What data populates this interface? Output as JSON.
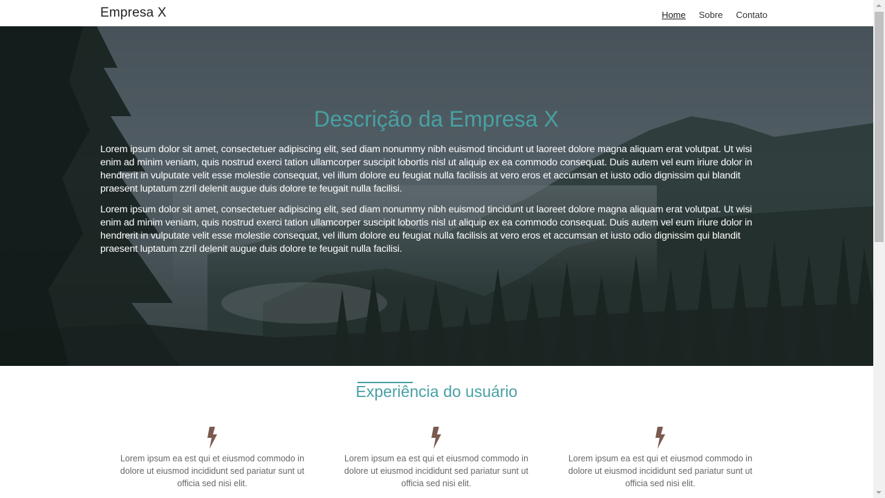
{
  "navbar": {
    "brand": "Empresa X",
    "links": [
      {
        "label": "Home",
        "active": true
      },
      {
        "label": "Sobre",
        "active": false
      },
      {
        "label": "Contato",
        "active": false
      }
    ]
  },
  "hero": {
    "title": "Descrição da Empresa X",
    "paragraphs": [
      "Lorem ipsum dolor sit amet, consectetuer adipiscing elit, sed diam nonummy nibh euismod tincidunt ut laoreet dolore magna aliquam erat volutpat. Ut wisi enim ad minim veniam, quis nostrud exerci tation ullamcorper suscipit lobortis nisl ut aliquip ex ea commodo consequat. Duis autem vel eum iriure dolor in hendrerit in vulputate velit esse molestie consequat, vel illum dolore eu feugiat nulla facilisis at vero eros et accumsan et iusto odio dignissim qui blandit praesent luptatum zzril delenit augue duis dolore te feugait nulla facilisi.",
      "Lorem ipsum dolor sit amet, consectetuer adipiscing elit, sed diam nonummy nibh euismod tincidunt ut laoreet dolore magna aliquam erat volutpat. Ut wisi enim ad minim veniam, quis nostrud exerci tation ullamcorper suscipit lobortis nisl ut aliquip ex ea commodo consequat. Duis autem vel eum iriure dolor in hendrerit in vulputate velit esse molestie consequat, vel illum dolore eu feugiat nulla facilisis at vero eros et accumsan et iusto odio dignissim qui blandit praesent luptatum zzril delenit augue duis dolore te feugait nulla facilisi."
    ]
  },
  "features": {
    "title": "Experiência do usuário",
    "items": [
      {
        "icon": "bolt-icon",
        "text": "Lorem ipsum ea est qui et eiusmod commodo in dolore ut eiusmod incididunt sed pariatur sunt ut officia sed nisi elit."
      },
      {
        "icon": "bolt-icon",
        "text": "Lorem ipsum ea est qui et eiusmod commodo in dolore ut eiusmod incididunt sed pariatur sunt ut officia sed nisi elit."
      },
      {
        "icon": "bolt-icon",
        "text": "Lorem ipsum ea est qui et eiusmod commodo in dolore ut eiusmod incididunt sed pariatur sunt ut officia sed nisi elit."
      }
    ]
  },
  "colors": {
    "accent": "#49a0a3",
    "icon": "#7a5a4e"
  }
}
